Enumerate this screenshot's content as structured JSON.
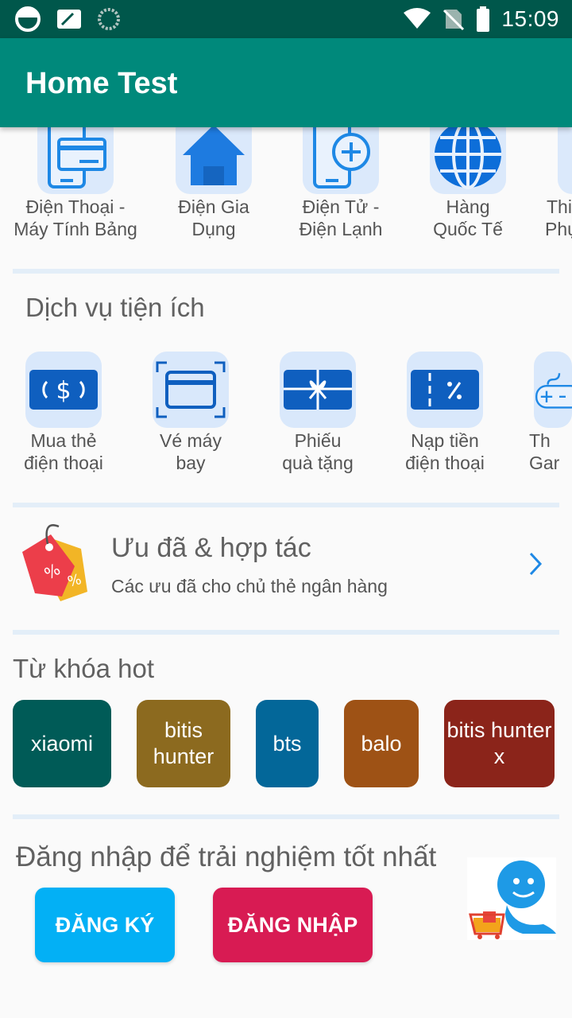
{
  "status_bar": {
    "time": "15:09"
  },
  "app_bar": {
    "title": "Home Test"
  },
  "categories": [
    {
      "label_1": "Điện Thoại -",
      "label_2": "Máy Tính Bảng",
      "icon": "tablet-card-icon"
    },
    {
      "label_1": "Điện Gia",
      "label_2": "Dụng",
      "icon": "house-icon"
    },
    {
      "label_1": "Điện Tử -",
      "label_2": "Điện Lạnh",
      "icon": "phone-plus-icon"
    },
    {
      "label_1": "Hàng",
      "label_2": "Quốc Tế",
      "icon": "globe-icon"
    },
    {
      "label_1": "Thi",
      "label_2": "Phụ",
      "icon": "partial-icon"
    }
  ],
  "services": {
    "title": "Dịch vụ tiện ích",
    "items": [
      {
        "label_1": "Mua thẻ",
        "label_2": "điện thoại",
        "icon": "dollar-card-icon"
      },
      {
        "label_1": "Vé máy",
        "label_2": "bay",
        "icon": "ticket-card-icon"
      },
      {
        "label_1": "Phiếu",
        "label_2": "quà tặng",
        "icon": "gift-card-icon"
      },
      {
        "label_1": "Nạp tiền",
        "label_2": "điện thoại",
        "icon": "percent-card-icon"
      },
      {
        "label_1": "Th",
        "label_2": "Gar",
        "icon": "gamepad-icon"
      }
    ]
  },
  "promo": {
    "title": "Ưu đã & hợp tác",
    "subtitle": "Các ưu đã cho chủ thẻ ngân hàng",
    "icon": "discount-tag-icon"
  },
  "keywords": {
    "title": "Từ khóa hot",
    "items": [
      {
        "text": "xiaomi",
        "color": "#005b57"
      },
      {
        "text": "bitis hunter",
        "color": "#8c6a1f"
      },
      {
        "text": "bts",
        "color": "#036799"
      },
      {
        "text": "balo",
        "color": "#9e5215"
      },
      {
        "text": "bitis hunter x",
        "color": "#8b241a"
      }
    ]
  },
  "login": {
    "title": "Đăng nhập để trải nghiệm tốt nhất",
    "register_label": "ĐĂNG KÝ",
    "login_label": "ĐĂNG NHẬP",
    "register_color": "#03b0f5",
    "login_color": "#d81b53"
  }
}
